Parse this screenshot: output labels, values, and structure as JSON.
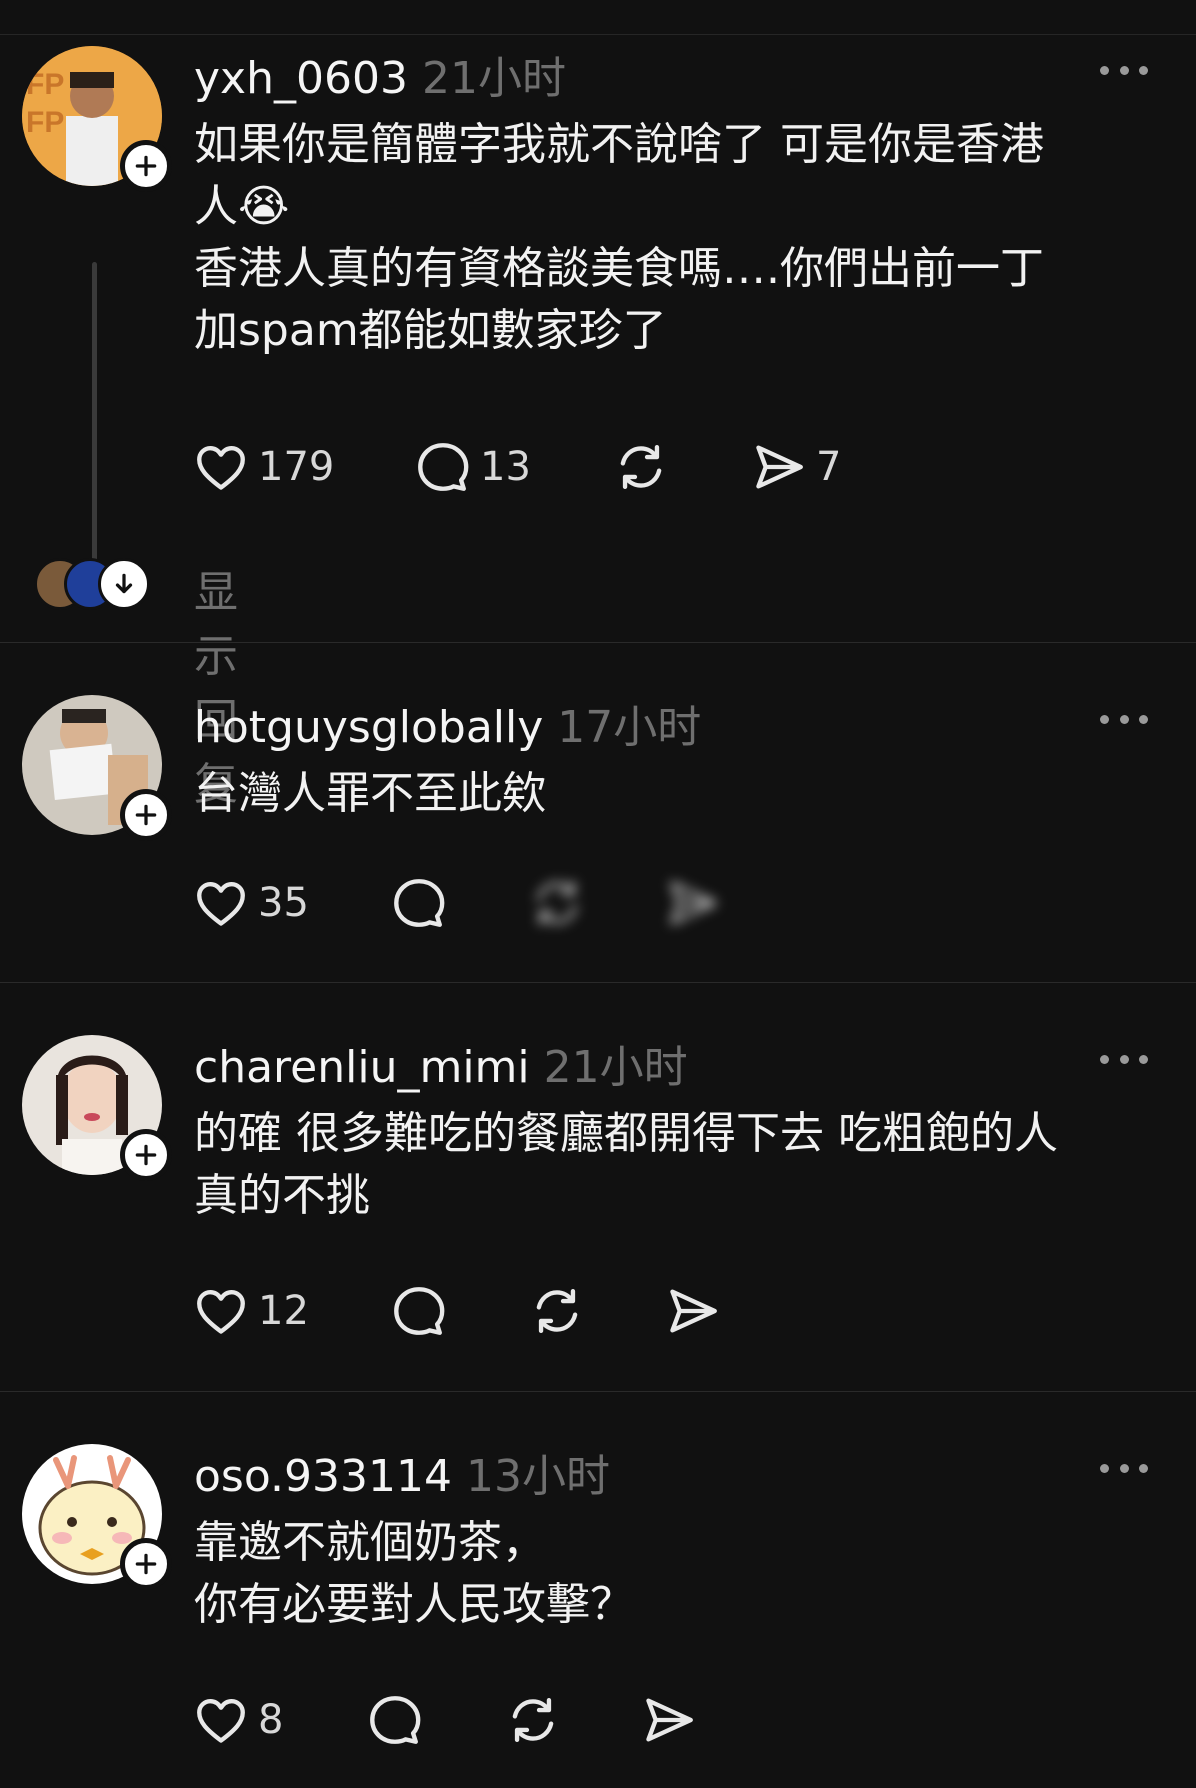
{
  "posts": [
    {
      "username": "yxh_0603",
      "time": "21小时",
      "text": "如果你是簡體字我就不說啥了 可是你是香港\n人😭\n香港人真的有資格談美食嗎….你們出前一丁\n加spam都能如數家珍了",
      "likes": "179",
      "comments": "13",
      "reposts": "",
      "shares": "7",
      "show_replies": "显示回复"
    },
    {
      "username": "hotguysglobally",
      "time": "17小时",
      "text": "台灣人罪不至此欸",
      "likes": "35",
      "comments": "",
      "reposts": "",
      "shares": ""
    },
    {
      "username": "charenliu_mimi",
      "time": "21小时",
      "text": "的確 很多難吃的餐廳都開得下去 吃粗飽的人\n真的不挑",
      "likes": "12",
      "comments": "",
      "reposts": "",
      "shares": ""
    },
    {
      "username": "oso.933114",
      "time": "13小时",
      "text": "靠邀不就個奶茶，\n你有必要對人民攻擊？",
      "likes": "8",
      "comments": "",
      "reposts": "",
      "shares": ""
    }
  ],
  "icons": {
    "like": "heart-icon",
    "comment": "comment-bubble-icon",
    "repost": "repost-icon",
    "share": "send-icon",
    "follow": "plus-icon",
    "more": "more-dots-icon",
    "expand": "arrow-down-icon"
  },
  "colors": {
    "background": "#111111",
    "text": "#f2f2f2",
    "muted": "#6f6f6f",
    "divider": "#2a2a2a"
  }
}
